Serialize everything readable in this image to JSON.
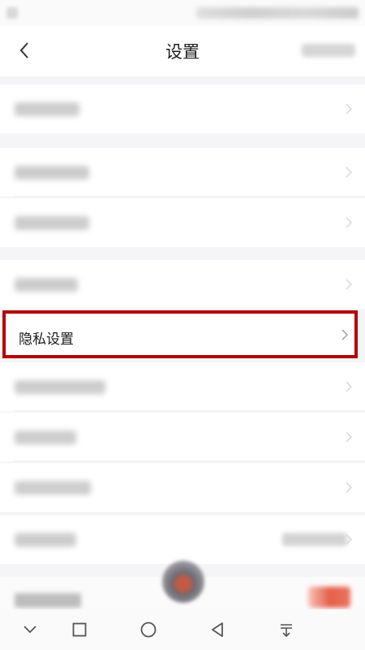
{
  "header": {
    "title": "设置",
    "back_icon": "chevron-left-icon"
  },
  "list": {
    "highlighted_item": {
      "label": "隐私设置",
      "icon": "chevron-right-icon"
    }
  },
  "navigation": {
    "icons": [
      "chevron-down-icon",
      "square-icon",
      "circle-icon",
      "triangle-back-icon",
      "menu-download-icon"
    ]
  },
  "colors": {
    "highlight_border": "#b40000",
    "accent": "#e5604a"
  }
}
